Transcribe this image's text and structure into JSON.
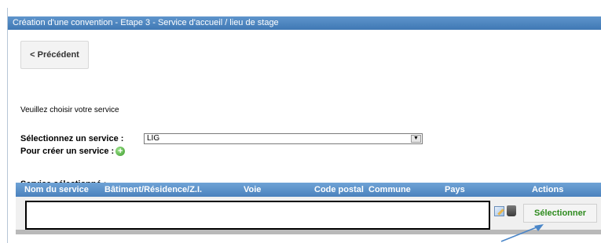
{
  "titlebar": {
    "title": "Création d'une convention - Etape 3 - Service d'accueil / lieu de stage"
  },
  "nav": {
    "previous_label": "< Précédent"
  },
  "form": {
    "prompt": "Veuillez choisir votre service",
    "select_label": "Sélectionnez un service :",
    "select_value": "LIG",
    "create_label": "Pour créer un service :"
  },
  "selected": {
    "title": "Service sélectionné :",
    "columns": [
      "Nom du service",
      "Bâtiment/Résidence/Z.I.",
      "Voie",
      "Code postal",
      "Commune",
      "Pays",
      "Actions"
    ],
    "select_button_label": "Sélectionner"
  },
  "icons": {
    "dropdown": "chevron-down-icon",
    "add": "plus-circle-icon",
    "edit": "edit-icon",
    "delete": "trash-icon"
  },
  "colors": {
    "titlebar": "#3f78b4",
    "table_header": "#5a90c8",
    "select_button_text": "#2e8b1e",
    "add_icon": "#3c9a2c",
    "annotation_arrow": "#4a86c8"
  }
}
